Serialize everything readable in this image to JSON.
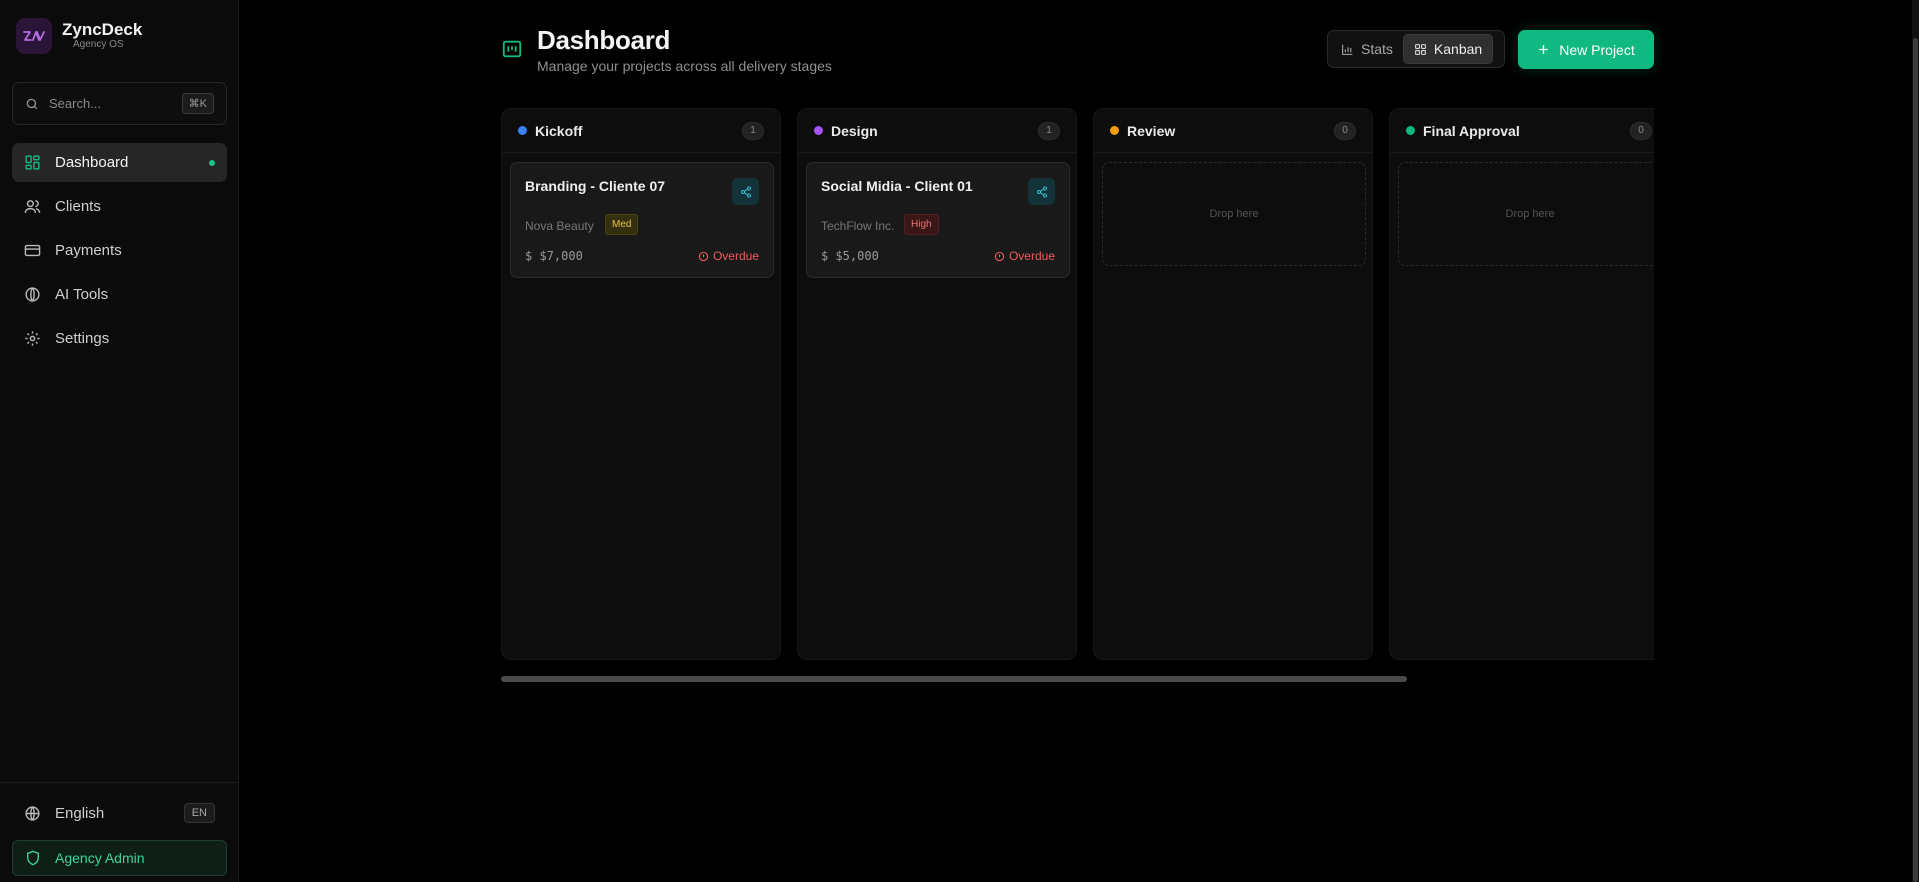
{
  "brand": {
    "name": "ZyncDeck",
    "subtitle": "Agency OS",
    "logo_icon": "zyncdeck-logo-icon"
  },
  "search": {
    "placeholder": "Search...",
    "shortcut": "⌘K"
  },
  "nav": [
    {
      "label": "Dashboard",
      "icon": "grid-icon",
      "active": true
    },
    {
      "label": "Clients",
      "icon": "users-icon",
      "active": false
    },
    {
      "label": "Payments",
      "icon": "credit-card-icon",
      "active": false
    },
    {
      "label": "AI Tools",
      "icon": "globe-icon",
      "active": false
    },
    {
      "label": "Settings",
      "icon": "gear-icon",
      "active": false
    }
  ],
  "language": {
    "label": "English",
    "code": "EN"
  },
  "role": {
    "label": "Agency Admin"
  },
  "header": {
    "title": "Dashboard",
    "subtitle": "Manage your projects across all delivery stages"
  },
  "view_toggle": {
    "stats": "Stats",
    "kanban": "Kanban",
    "selected": "Kanban"
  },
  "new_project": "New Project",
  "columns": [
    {
      "title": "Kickoff",
      "count": "1",
      "color": "#3b82f6",
      "card": {
        "title": "Branding - Cliente 07",
        "client": "Nova Beauty",
        "priority": "Med",
        "amount": "$ $7,000",
        "status": "Overdue"
      }
    },
    {
      "title": "Design",
      "count": "1",
      "color": "#a855f7",
      "card": {
        "title": "Social Midia - Client 01",
        "client": "TechFlow Inc.",
        "priority": "High",
        "amount": "$ $5,000",
        "status": "Overdue"
      }
    },
    {
      "title": "Review",
      "count": "0",
      "color": "#f59e0b",
      "drop": "Drop here"
    },
    {
      "title": "Final Approval",
      "count": "0",
      "color": "#10b981",
      "drop": "Drop here"
    }
  ],
  "colors": {
    "accent": "#10b981",
    "overdue": "#ef5b5b"
  }
}
